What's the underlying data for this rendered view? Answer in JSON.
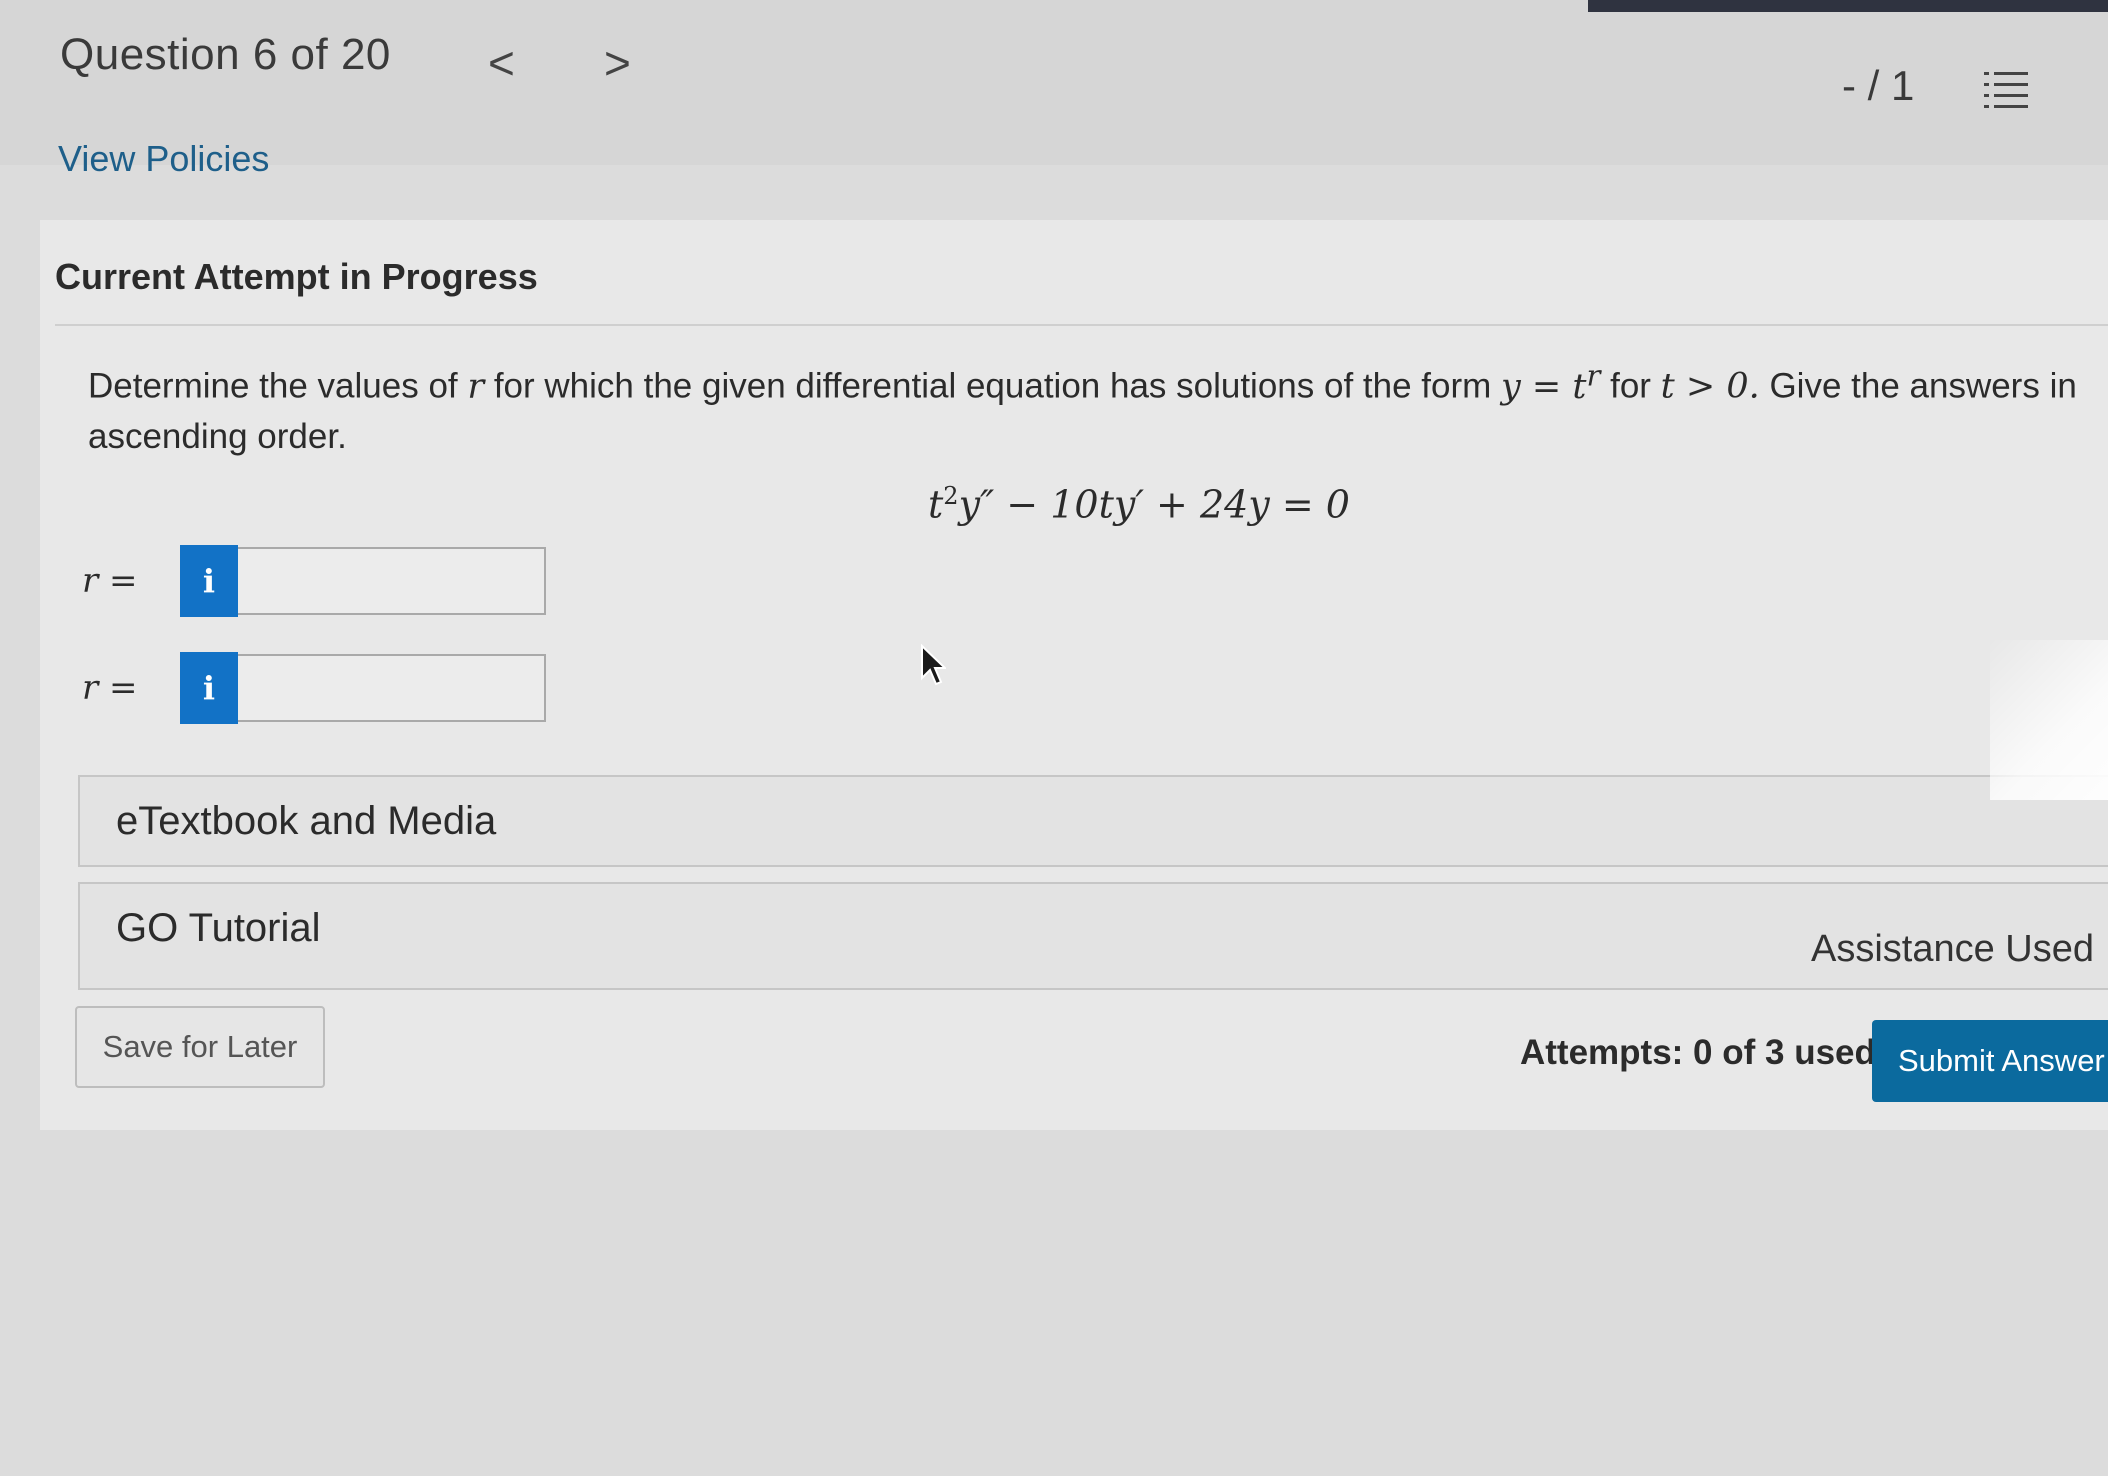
{
  "header": {
    "question_counter": "Question 6 of 20",
    "prev_glyph": "<",
    "next_glyph": ">",
    "score": "- / 1"
  },
  "links": {
    "view_policies": "View Policies"
  },
  "attempt": {
    "heading": "Current Attempt in Progress"
  },
  "question": {
    "text_1": "Determine the values of ",
    "text_r": "r",
    "text_2": " for which the given differential equation has solutions of the form ",
    "form": "y = t",
    "form_exp": "r",
    "text_3": " for ",
    "condition": "t > 0.",
    "text_4": " Give the answers in ascending order.",
    "equation_pre": "t",
    "equation_exp": "2",
    "equation_post": "y″ − 10ty′ + 24y = 0"
  },
  "answers": [
    {
      "label": "r =",
      "info": "i",
      "value": ""
    },
    {
      "label": "r =",
      "info": "i",
      "value": ""
    }
  ],
  "resources": {
    "etextbook_label": "eTextbook and Media",
    "tutorial_label": "GO Tutorial",
    "assistance_label": "Assistance Used"
  },
  "footer": {
    "save_label": "Save for Later",
    "attempts_label": "Attempts: 0 of 3 used",
    "submit_label": "Submit Answer"
  },
  "icons": {
    "list": "list-icon",
    "info": "info-icon",
    "cursor": "cursor-icon"
  },
  "colors": {
    "accent_blue": "#1272c6",
    "submit_blue": "#0b6a9e",
    "link_blue": "#1e5f8a"
  }
}
